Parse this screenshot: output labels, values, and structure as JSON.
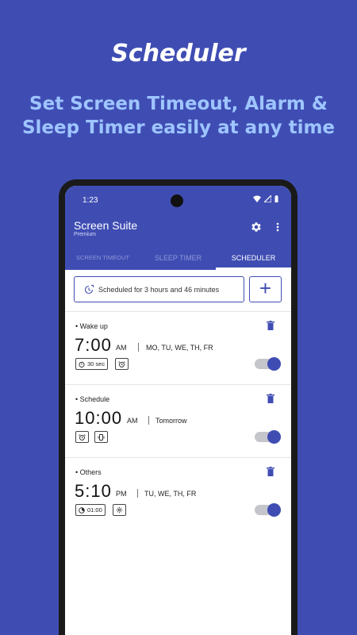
{
  "promo": {
    "title": "Scheduler",
    "subtitle": "Set Screen Timeout, Alarm & Sleep Timer easily at any time"
  },
  "status_bar": {
    "time": "1:23"
  },
  "app": {
    "title": "Screen Suite",
    "subtitle": "Premium"
  },
  "tabs": [
    {
      "label": "SCREEN TIMEOUT",
      "active": false
    },
    {
      "label": "SLEEP TIMER",
      "active": false
    },
    {
      "label": "SCHEDULER",
      "active": true
    }
  ],
  "schedule_summary": {
    "text": "Scheduled for 3 hours and 46 minutes",
    "add_label": "+"
  },
  "alarms": [
    {
      "name": "• Wake up",
      "time": "7:00",
      "ampm": "AM",
      "days": "MO, TU, WE, TH, FR",
      "chips": [
        {
          "icon": "timer-icon",
          "label": "30 sec"
        },
        {
          "icon": "alarm-clock-icon",
          "label": ""
        }
      ],
      "enabled": true
    },
    {
      "name": "• Schedule",
      "time": "10:00",
      "ampm": "AM",
      "days": "Tomorrow",
      "chips": [
        {
          "icon": "alarm-clock-icon",
          "label": ""
        },
        {
          "icon": "vibrate-icon",
          "label": ""
        }
      ],
      "enabled": true
    },
    {
      "name": "• Others",
      "time": "5:10",
      "ampm": "PM",
      "days": "TU, WE, TH, FR",
      "chips": [
        {
          "icon": "sleep-timer-icon",
          "label": "01:00"
        },
        {
          "icon": "gear-icon",
          "label": ""
        }
      ],
      "enabled": true
    }
  ],
  "colors": {
    "primary": "#3f4db3",
    "promo_subtitle": "#9ec5ff",
    "toggle_track": "#c4c6cc"
  }
}
